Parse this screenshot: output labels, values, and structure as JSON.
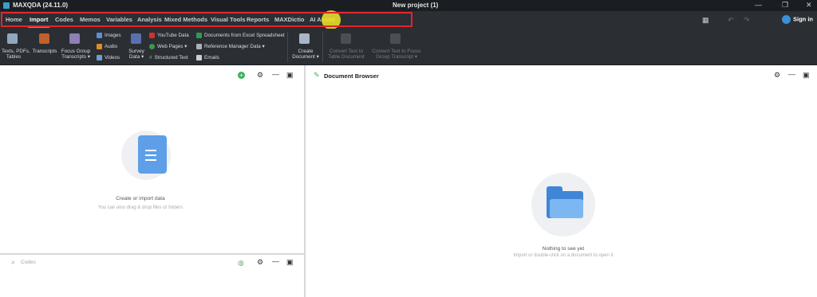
{
  "window": {
    "app_title": "MAXQDA (24.11.0)",
    "project_title": "New project (1)",
    "minimize": "—",
    "restore": "❐",
    "close": "✕"
  },
  "menu": {
    "tabs": [
      "Home",
      "Import",
      "Codes",
      "Memos",
      "Variables",
      "Analysis",
      "Mixed Methods",
      "Visual Tools",
      "Reports",
      "MAXDictio",
      "AI Assist"
    ],
    "active_tab": "Import",
    "sign_in": "Sign in"
  },
  "ribbon": {
    "texts_pdfs_tables": "Texts, PDFs,\nTables",
    "transcripts": "Transcripts",
    "focus_group_transcripts": "Focus Group\nTranscripts ▾",
    "images": "Images",
    "audio": "Audio",
    "videos": "Videos",
    "survey_data": "Survey\nData ▾",
    "youtube_data": "YouTube Data",
    "web_pages": "Web Pages ▾",
    "structured_text": "Structured Text",
    "documents_from_excel": "Documents from Excel Spreadsheet",
    "reference_manager_data": "Reference Manager Data ▾",
    "emails": "Emails",
    "create_document": "Create\nDocument ▾",
    "convert_text_to_table": "Convert Text to\nTable Document",
    "convert_text_to_focus": "Convert Text to Focus\nGroup Transcript ▾"
  },
  "document_system": {
    "empty_title": "Create or import data",
    "empty_subtitle": "You can also drag & drop files or folders"
  },
  "document_browser": {
    "title": "Document Browser",
    "empty_title": "Nothing to see yet",
    "empty_subtitle": "Import or double-click on a document to open it"
  },
  "codes": {
    "search_placeholder": "Codes"
  },
  "colors": {
    "highlight_box": "#e3262c",
    "annotation_arrow": "#e3262c",
    "cursor_highlight": "#f0e628",
    "accent": "#4aa3df"
  }
}
